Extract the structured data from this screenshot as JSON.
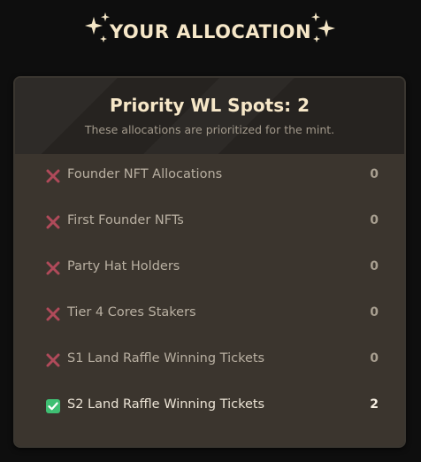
{
  "header": {
    "title": "YOUR ALLOCATION",
    "left_icon": "sparkle-icon",
    "right_icon": "sparkle-icon"
  },
  "panel": {
    "title": "Priority WL Spots: 2",
    "subtitle": "These allocations are prioritized for the mint."
  },
  "allocations": [
    {
      "label": "Founder NFT Allocations",
      "value": "0",
      "status": "cross"
    },
    {
      "label": "First Founder NFTs",
      "value": "0",
      "status": "cross"
    },
    {
      "label": "Party Hat Holders",
      "value": "0",
      "status": "cross"
    },
    {
      "label": "Tier 4 Cores Stakers",
      "value": "0",
      "status": "cross"
    },
    {
      "label": "S1 Land Raffle Winning Tickets",
      "value": "0",
      "status": "cross"
    },
    {
      "label": "S2 Land Raffle Winning Tickets",
      "value": "2",
      "status": "check"
    }
  ],
  "colors": {
    "background": "#0e0e0e",
    "title_text": "#f6e7c8",
    "cross_icon": "#b04a5a",
    "check_icon": "#3fbf73"
  }
}
